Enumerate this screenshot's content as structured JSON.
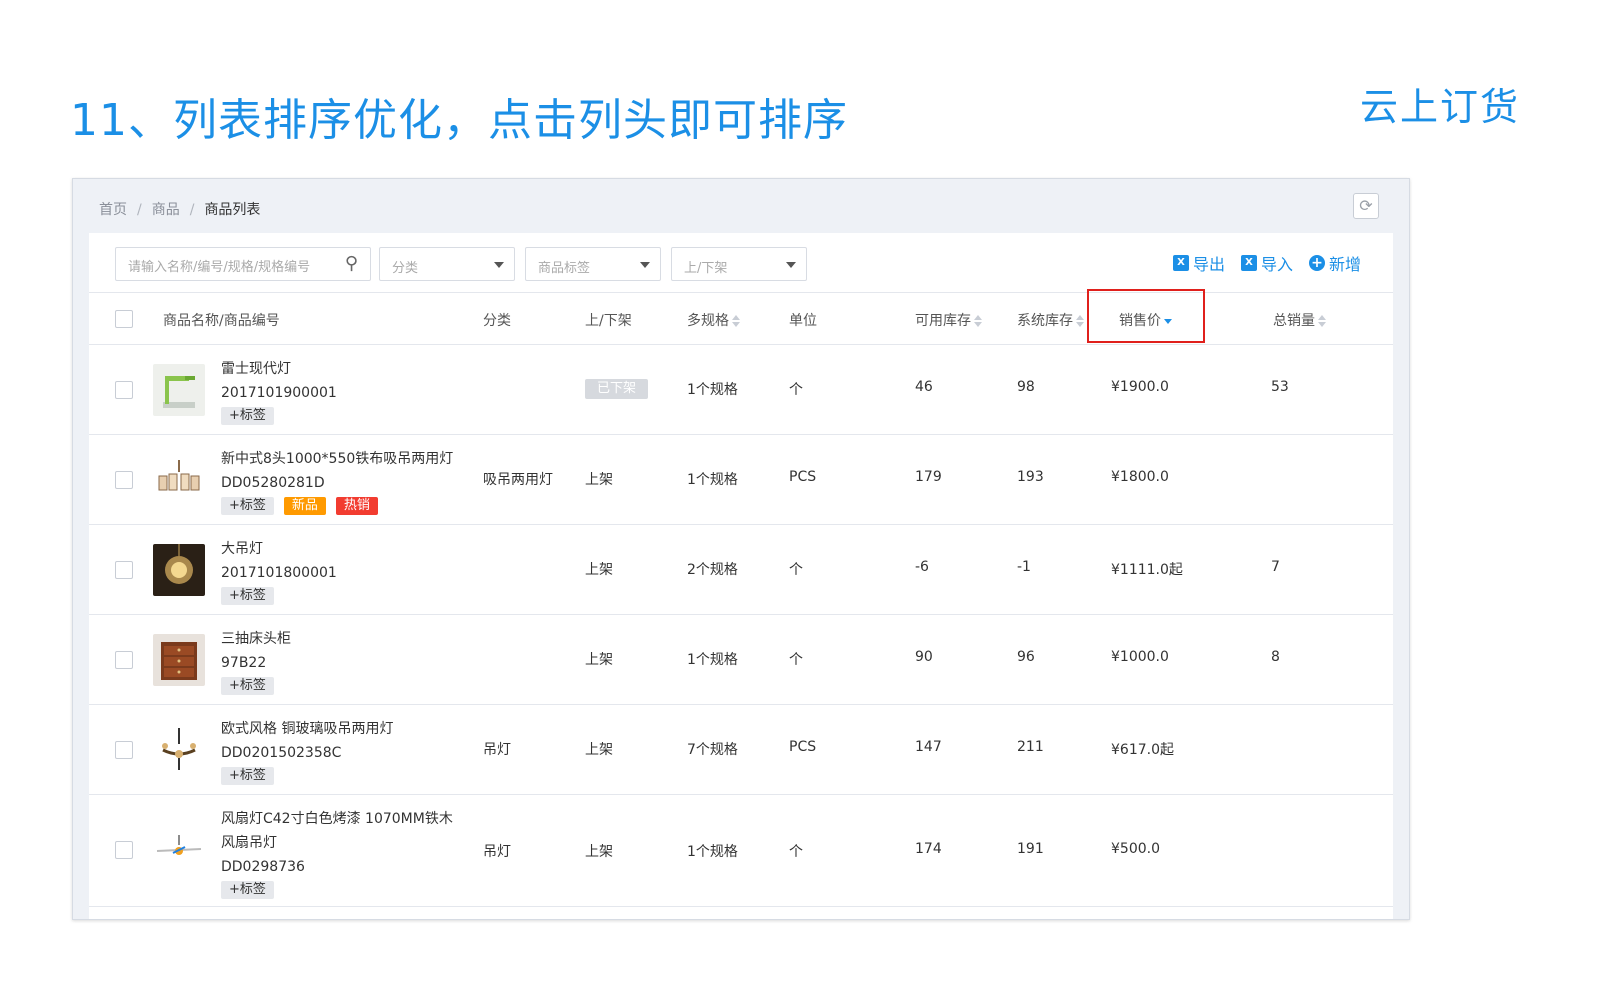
{
  "slide": {
    "title": "11、列表排序优化，点击列头即可排序",
    "brand": "云上订货"
  },
  "breadcrumb": [
    "首页",
    "商品",
    "商品列表"
  ],
  "toolbar": {
    "search_placeholder": "请输入名称/编号/规格/规格编号",
    "filters": [
      "分类",
      "商品标签",
      "上/下架"
    ],
    "export_label": "导出",
    "import_label": "导入",
    "add_label": "新增"
  },
  "columns": {
    "name": "商品名称/商品编号",
    "category": "分类",
    "status": "上/下架",
    "specs": "多规格",
    "unit": "单位",
    "available": "可用库存",
    "system": "系统库存",
    "price": "销售价",
    "sales": "总销量"
  },
  "sort": {
    "column": "price",
    "direction": "desc"
  },
  "rows": [
    {
      "name": "雷士现代灯",
      "code": "2017101900001",
      "tags": [
        "+标签"
      ],
      "category": "",
      "status": "已下架",
      "specs": "1个规格",
      "unit": "个",
      "available": "46",
      "system": "98",
      "price": "¥1900.0",
      "sales": "53"
    },
    {
      "name": "新中式8头1000*550铁布吸吊两用灯",
      "code": "DD05280281D",
      "tags": [
        "+标签",
        "新品",
        "热销"
      ],
      "category": "吸吊两用灯",
      "status": "上架",
      "specs": "1个规格",
      "unit": "PCS",
      "available": "179",
      "system": "193",
      "price": "¥1800.0",
      "sales": ""
    },
    {
      "name": "大吊灯",
      "code": "2017101800001",
      "tags": [
        "+标签"
      ],
      "category": "",
      "status": "上架",
      "specs": "2个规格",
      "unit": "个",
      "available": "-6",
      "system": "-1",
      "price": "¥1111.0起",
      "sales": "7"
    },
    {
      "name": "三抽床头柜",
      "code": "97B22",
      "tags": [
        "+标签"
      ],
      "category": "",
      "status": "上架",
      "specs": "1个规格",
      "unit": "个",
      "available": "90",
      "system": "96",
      "price": "¥1000.0",
      "sales": "8"
    },
    {
      "name": "欧式风格 铜玻璃吸吊两用灯",
      "code": "DD0201502358C",
      "tags": [
        "+标签"
      ],
      "category": "吊灯",
      "status": "上架",
      "specs": "7个规格",
      "unit": "PCS",
      "available": "147",
      "system": "211",
      "price": "¥617.0起",
      "sales": ""
    },
    {
      "name": "风扇灯C42寸白色烤漆 1070MM铁木风扇吊灯",
      "code": "DD0298736",
      "tags": [
        "+标签"
      ],
      "category": "吊灯",
      "status": "上架",
      "specs": "1个规格",
      "unit": "个",
      "available": "174",
      "system": "191",
      "price": "¥500.0",
      "sales": ""
    }
  ]
}
